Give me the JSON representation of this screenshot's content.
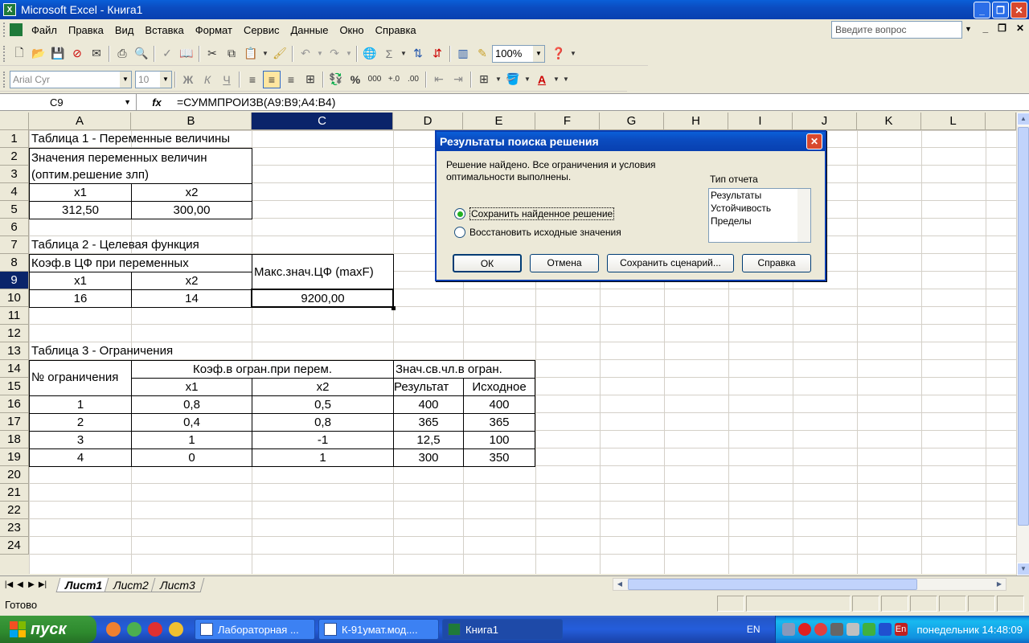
{
  "window": {
    "title": "Microsoft Excel - Книга1",
    "app_icon": "X"
  },
  "menu": {
    "items": [
      "Файл",
      "Правка",
      "Вид",
      "Вставка",
      "Формат",
      "Сервис",
      "Данные",
      "Окно",
      "Справка"
    ],
    "ask_placeholder": "Введите вопрос"
  },
  "toolbar": {
    "zoom": "100%",
    "font_name": "Arial Cyr",
    "font_size": "10",
    "bold": "Ж",
    "italic": "К",
    "underline": "Ч",
    "percent": "%",
    "thousands": "000",
    "sigma": "Σ"
  },
  "formula_bar": {
    "name_box": "C9",
    "fx": "fx",
    "formula": "=СУММПРОИЗВ(A9:B9;A4:B4)"
  },
  "columns": [
    "A",
    "B",
    "C",
    "D",
    "E",
    "F",
    "G",
    "H",
    "I",
    "J",
    "K",
    "L"
  ],
  "rows": [
    "1",
    "2",
    "3",
    "4",
    "5",
    "6",
    "7",
    "8",
    "9",
    "10",
    "11",
    "12",
    "13",
    "14",
    "15",
    "16",
    "17",
    "18",
    "19",
    "20",
    "21",
    "22",
    "23",
    "24"
  ],
  "sheet": {
    "t1_title": "Таблица 1 - Переменные величины",
    "t1_header_l1": "Значения переменных величин",
    "t1_header_l2": "(оптим.решение злп)",
    "t1_x1": "x1",
    "t1_x2": "x2",
    "t1_v1": "312,50",
    "t1_v2": "300,00",
    "t2_title": "Таблица 2 - Целевая функция",
    "t2_coef": "Коэф.в ЦФ при переменных",
    "t2_max": "Макс.знач.ЦФ (maxF)",
    "t2_x1": "x1",
    "t2_x2": "x2",
    "t2_c1": "16",
    "t2_c2": "14",
    "t2_result": "9200,00",
    "t3_title": "Таблица 3 - Ограничения",
    "t3_num": "№ ограничения",
    "t3_coef": "Коэф.в огран.при перем.",
    "t3_rhs": "Знач.св.чл.в огран.",
    "t3_x1": "x1",
    "t3_x2": "x2",
    "t3_res": "Результат",
    "t3_src": "Исходное",
    "t3_rows": [
      [
        "1",
        "0,8",
        "0,5",
        "400",
        "400"
      ],
      [
        "2",
        "0,4",
        "0,8",
        "365",
        "365"
      ],
      [
        "3",
        "1",
        "-1",
        "12,5",
        "100"
      ],
      [
        "4",
        "0",
        "1",
        "300",
        "350"
      ]
    ]
  },
  "sheet_tabs": [
    "Лист1",
    "Лист2",
    "Лист3"
  ],
  "status": {
    "ready": "Готово"
  },
  "dialog": {
    "title": "Результаты поиска решения",
    "message": "Решение найдено. Все ограничения и условия оптимальности выполнены.",
    "report_type_label": "Тип отчета",
    "reports": [
      "Результаты",
      "Устойчивость",
      "Пределы"
    ],
    "radio_keep": "Сохранить найденное решение",
    "radio_restore": "Восстановить исходные значения",
    "btn_ok": "ОК",
    "btn_cancel": "Отмена",
    "btn_save_scenario": "Сохранить сценарий...",
    "btn_help": "Справка"
  },
  "taskbar": {
    "start": "пуск",
    "items": [
      "Лабораторная ...",
      "К-91умат.мод....",
      "Книга1"
    ],
    "lang": "EN",
    "tray_lang": "En",
    "clock": "понедельник 14:48:09"
  }
}
